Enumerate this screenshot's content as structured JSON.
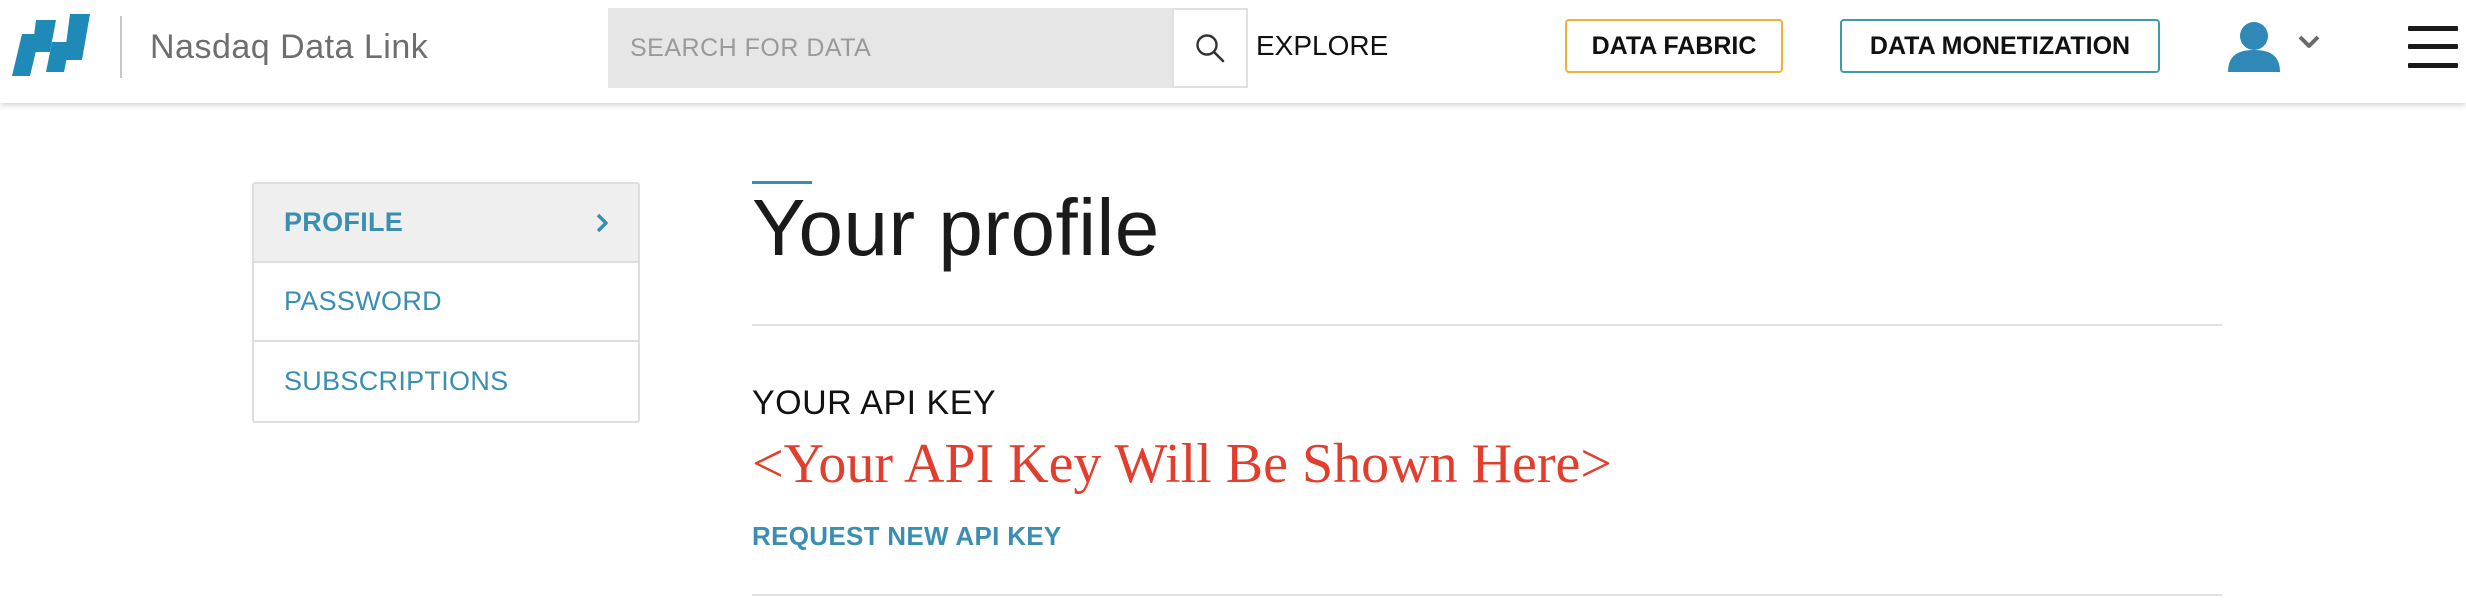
{
  "header": {
    "brand": "Nasdaq Data Link",
    "logo_icon": "nasdaq-n-logo",
    "search": {
      "placeholder": "SEARCH FOR DATA",
      "value": "",
      "icon": "search-icon"
    },
    "explore_label": "EXPLORE",
    "data_fabric_label": "DATA FABRIC",
    "data_monetization_label": "DATA MONETIZATION",
    "user_icon": "user-avatar-icon",
    "menu_icon": "hamburger-menu-icon"
  },
  "colors": {
    "accent_blue": "#3a8fb0",
    "logo_blue": "#1f8ab8",
    "data_fabric_border": "#f0b13a",
    "data_monetization_border": "#3e9aa8",
    "api_key_red": "#e23e2e"
  },
  "sidebar": {
    "items": [
      {
        "label": "PROFILE",
        "active": true
      },
      {
        "label": "PASSWORD",
        "active": false
      },
      {
        "label": "SUBSCRIPTIONS",
        "active": false
      }
    ]
  },
  "main": {
    "title": "Your profile",
    "api_key_heading": "YOUR API KEY",
    "api_key_value": "<Your API Key Will Be Shown Here>",
    "request_link": "REQUEST NEW API KEY"
  }
}
